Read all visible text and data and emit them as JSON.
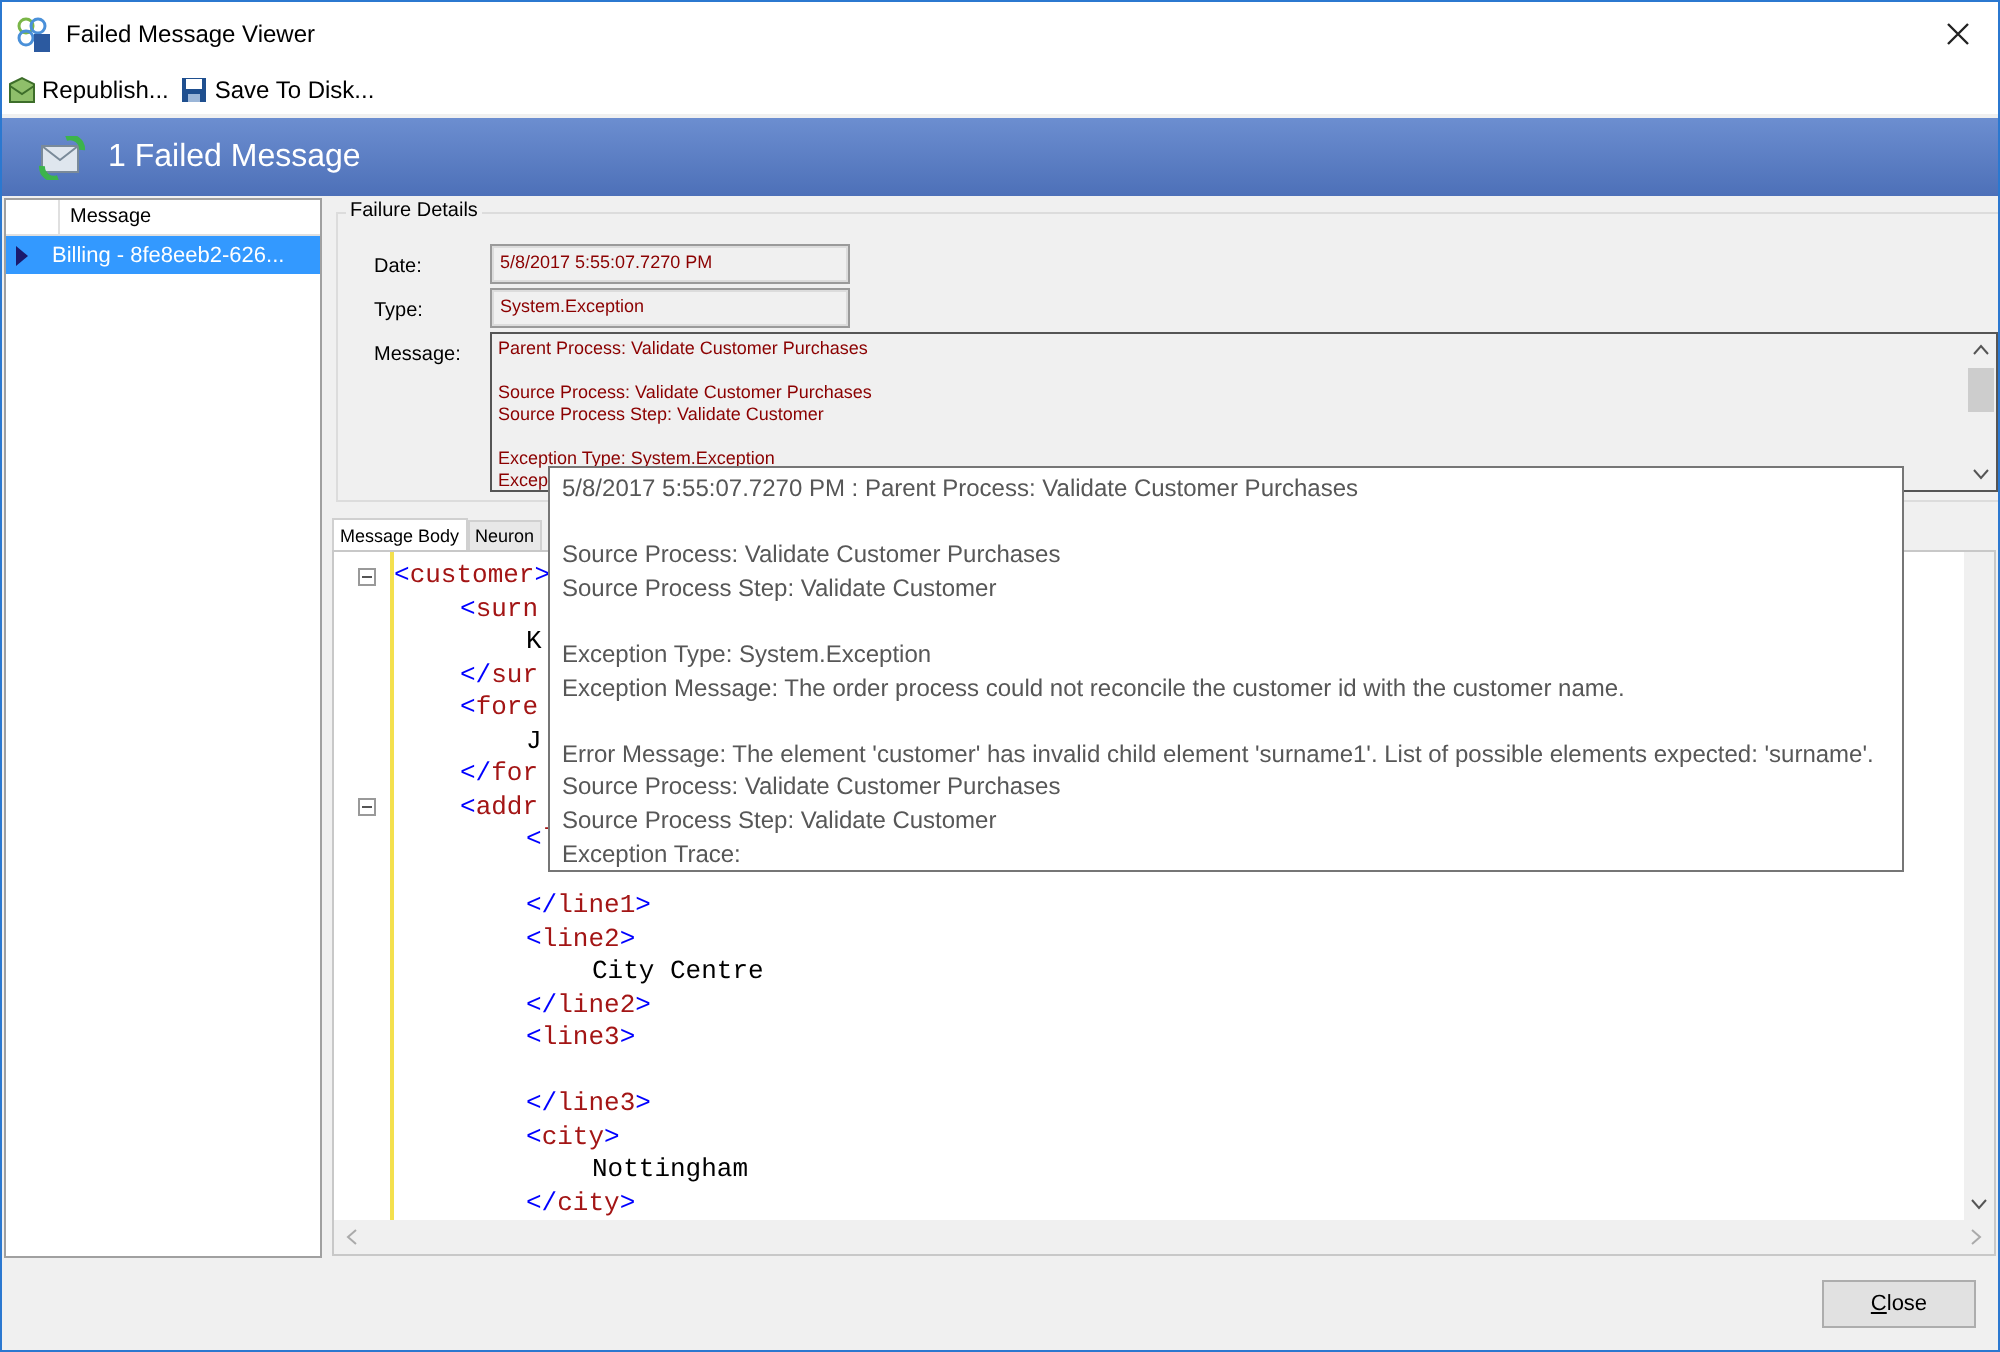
{
  "window": {
    "title": "Failed Message Viewer"
  },
  "toolbar": [
    {
      "label": "Republish...",
      "kind": "republish"
    },
    {
      "label": "Save To Disk...",
      "kind": "save"
    }
  ],
  "banner": {
    "title": "1 Failed Message"
  },
  "message_list": {
    "columns": [
      "Message"
    ],
    "rows": [
      {
        "text": "Billing - 8fe8eeb2-626...",
        "selected": true
      }
    ]
  },
  "failure_details": {
    "title": "Failure Details",
    "fields": [
      {
        "label": "Date:",
        "value": "5/8/2017 5:55:07.7270 PM"
      },
      {
        "label": "Type:",
        "value": "System.Exception"
      }
    ],
    "message": {
      "label": "Message:",
      "paragraphs": [
        [
          "Parent Process: Validate Customer Purchases"
        ],
        [
          "Source Process: Validate Customer Purchases",
          "Source Process Step: Validate Customer"
        ],
        [
          "Exception Type: System.Exception",
          "Excep"
        ]
      ]
    }
  },
  "tabs": [
    {
      "label": "Message Body",
      "selected": true
    },
    {
      "label": "Neuron",
      "selected": false
    }
  ],
  "code_lines": [
    {
      "text": "<customer>",
      "kind": "tag",
      "fold": true,
      "children": [
        {
          "text": "<surn",
          "kind": "tag",
          "children": [
            {
              "text": "K",
              "kind": "text"
            }
          ]
        },
        {
          "text": "</sur",
          "kind": "tag"
        },
        {
          "text": "<fore",
          "kind": "tag",
          "children": [
            {
              "text": "J",
              "kind": "text"
            }
          ]
        },
        {
          "text": "</for",
          "kind": "tag"
        },
        {
          "text": "<addr",
          "kind": "tag",
          "fold": true,
          "children": [
            {
              "text": "<l",
              "kind": "tag",
              "children": [
                {
                  "kind": "blank"
                }
              ]
            },
            {
              "text": "</line1>",
              "kind": "tag"
            },
            {
              "text": "<line2>",
              "kind": "tag",
              "children": [
                {
                  "text": "City Centre",
                  "kind": "text"
                }
              ]
            },
            {
              "text": "</line2>",
              "kind": "tag"
            },
            {
              "text": "<line3>",
              "kind": "tag",
              "children": [
                {
                  "kind": "blank"
                }
              ]
            },
            {
              "text": "</line3>",
              "kind": "tag"
            },
            {
              "text": "<city>",
              "kind": "tag",
              "children": [
                {
                  "text": "Nottingham",
                  "kind": "text"
                }
              ]
            },
            {
              "text": "</city>",
              "kind": "tag"
            }
          ]
        }
      ]
    }
  ],
  "tooltip": {
    "paragraphs": [
      [
        "5/8/2017 5:55:07.7270 PM  : Parent Process: Validate Customer Purchases"
      ],
      [
        "Source Process: Validate Customer Purchases",
        "Source Process Step: Validate Customer"
      ],
      [
        "Exception Type: System.Exception",
        "Exception Message: The order process could not reconcile the customer id with the customer name."
      ],
      [
        "Error Message: The element 'customer' has invalid child element 'surname1'. List of possible elements expected: 'surname'.",
        "Source Process: Validate Customer Purchases",
        "Source Process Step: Validate Customer",
        "Exception Trace:"
      ]
    ]
  },
  "buttons": [
    {
      "label": "Close"
    }
  ]
}
